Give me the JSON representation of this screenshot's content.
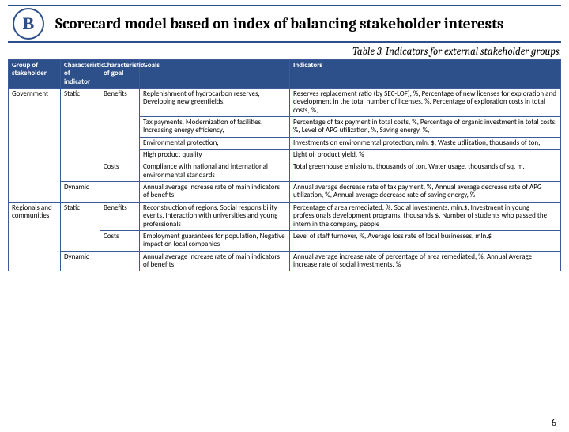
{
  "header": {
    "logo_text": "В",
    "title": "Scorecard model based on index of balancing stakeholder interests"
  },
  "caption": "Table 3. Indicators for external stakeholder groups.",
  "columns": {
    "group": "Group of stakeholder",
    "char_ind": "Characteristic of indicator",
    "char_goal": "Characteristic of goal",
    "goals": "Goals",
    "indicators": "Indicators"
  },
  "rows": {
    "gov": {
      "group": "Government",
      "static": "Static",
      "benefits": "Benefits",
      "goals_b1": "Replenishment of hydrocarbon reserves, Developing new greenfields,",
      "ind_b1": "Reserves replacement ratio (by SEC-LOF), %, Percentage of new licenses for exploration and development in the total number of licenses, %, Percentage of exploration costs in total costs, %,",
      "goals_b2": "Tax payments,\nModernization of facilities,\nIncreasing energy efficiency,",
      "ind_b2": "Percentage of tax payment in total costs, %,\nPercentage of organic investment in total costs, %,\nLevel of APG utilization, %,\nSaving energy, %,",
      "goals_b3": "Environmental protection,",
      "ind_b3": "Investments on environmental protection, mln. $,\nWaste utilization, thousands of ton,",
      "goals_b4": "High product quality",
      "ind_b4": "Light oil product yield, %",
      "costs": "Costs",
      "goals_c": "Compliance with national and international environmental standards",
      "ind_c": "Total greenhouse emissions, thousands of ton,\nWater usage, thousands of sq. m.",
      "dynamic": "Dynamic",
      "goals_d": "Annual average increase rate of main indicators of benefits",
      "ind_d": "Annual average decrease rate of tax payment, %,\nAnnual average decrease rate of APG utilization, %,\nAnnual average decrease rate of saving energy, %"
    },
    "reg": {
      "group": "Regionals and communities",
      "static": "Static",
      "benefits": "Benefits",
      "goals_b": "Reconstruction of regions,\nSocial responsibility events,\nInteraction with universities and young professionals",
      "ind_b": "Percentage of area remediated, %,\nSocial investments, mln.$,\nInvestment in young professionals development programs, thousands $,\nNumber of students who passed the intern in the company, people",
      "costs": "Costs",
      "goals_c": "Employment guarantees for population,\nNegative impact on local companies",
      "ind_c": "Level of staff turnover, %,\nAverage loss rate of local businesses, mln.$",
      "dynamic": "Dynamic",
      "goals_d": "Annual average increase rate of main indicators of benefits",
      "ind_d": "Annual average increase rate of percentage of area remediated, %, Annual Average increase rate of social investments, %"
    }
  },
  "pagenum": "6"
}
